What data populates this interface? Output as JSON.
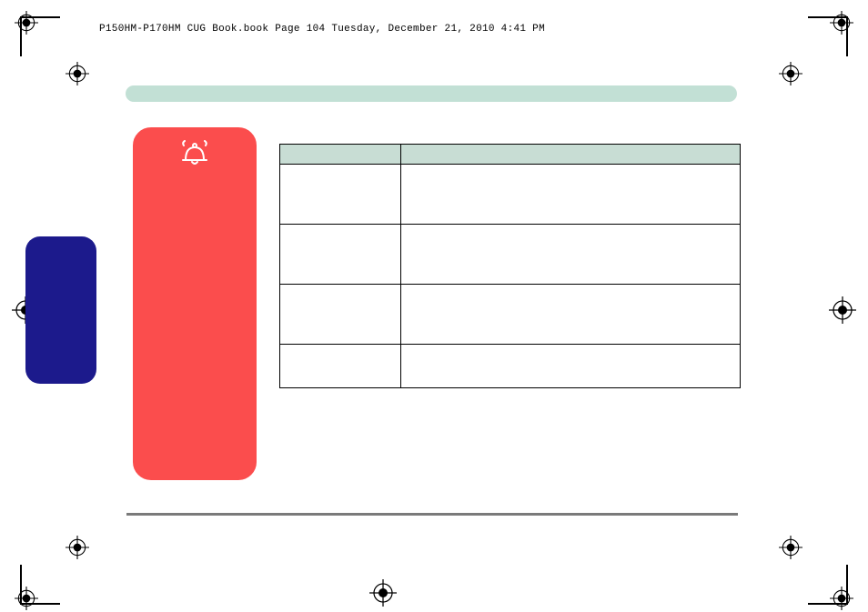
{
  "header": {
    "line": "P150HM-P170HM CUG Book.book  Page 104  Tuesday, December 21, 2010  4:41 PM"
  },
  "green_bar": {
    "title": ""
  },
  "red_callout": {
    "icon": "bell-alarm-icon",
    "text": ""
  },
  "blue_tab": {
    "label": ""
  },
  "table": {
    "headers": [
      "",
      ""
    ],
    "rows": [
      [
        "",
        ""
      ],
      [
        "",
        ""
      ],
      [
        "",
        ""
      ],
      [
        "",
        ""
      ]
    ]
  }
}
